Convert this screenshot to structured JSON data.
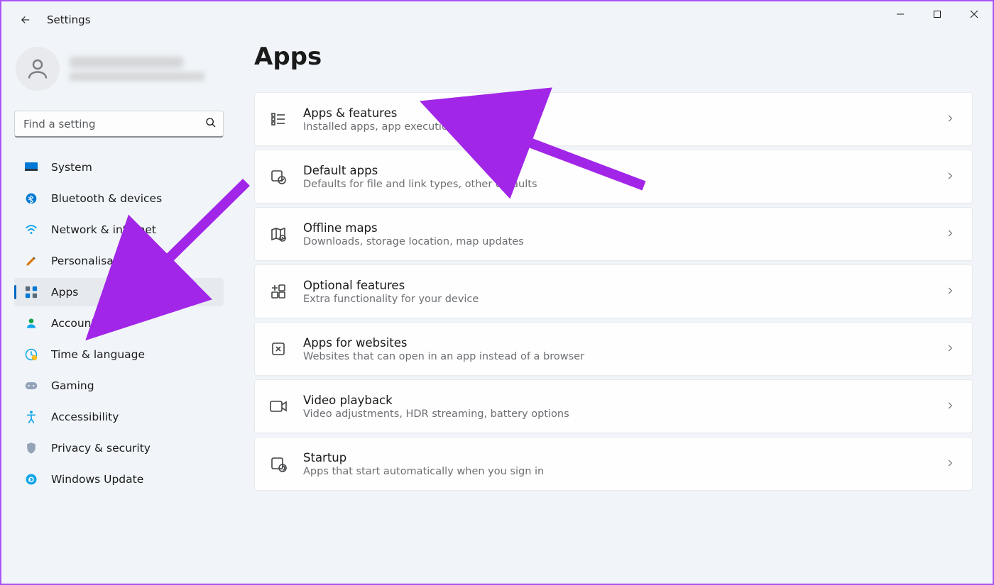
{
  "window": {
    "title": "Settings"
  },
  "profile": {
    "name_placeholder": "",
    "email_placeholder": ""
  },
  "search": {
    "placeholder": "Find a setting"
  },
  "sidebar": {
    "items": [
      {
        "id": "system",
        "label": "System",
        "active": false
      },
      {
        "id": "bluetooth",
        "label": "Bluetooth & devices",
        "active": false
      },
      {
        "id": "network",
        "label": "Network & internet",
        "active": false
      },
      {
        "id": "personalisation",
        "label": "Personalisation",
        "active": false
      },
      {
        "id": "apps",
        "label": "Apps",
        "active": true
      },
      {
        "id": "accounts",
        "label": "Accounts",
        "active": false
      },
      {
        "id": "time",
        "label": "Time & language",
        "active": false
      },
      {
        "id": "gaming",
        "label": "Gaming",
        "active": false
      },
      {
        "id": "accessibility",
        "label": "Accessibility",
        "active": false
      },
      {
        "id": "privacy",
        "label": "Privacy & security",
        "active": false
      },
      {
        "id": "update",
        "label": "Windows Update",
        "active": false
      }
    ]
  },
  "main": {
    "title": "Apps",
    "categories": [
      {
        "id": "apps-features",
        "title": "Apps & features",
        "desc": "Installed apps, app execution aliases"
      },
      {
        "id": "default-apps",
        "title": "Default apps",
        "desc": "Defaults for file and link types, other defaults"
      },
      {
        "id": "offline-maps",
        "title": "Offline maps",
        "desc": "Downloads, storage location, map updates"
      },
      {
        "id": "optional",
        "title": "Optional features",
        "desc": "Extra functionality for your device"
      },
      {
        "id": "websites",
        "title": "Apps for websites",
        "desc": "Websites that can open in an app instead of a browser"
      },
      {
        "id": "video",
        "title": "Video playback",
        "desc": "Video adjustments, HDR streaming, battery options"
      },
      {
        "id": "startup",
        "title": "Startup",
        "desc": "Apps that start automatically when you sign in"
      }
    ]
  },
  "annotation": {
    "arrow_color": "#a226e8"
  }
}
